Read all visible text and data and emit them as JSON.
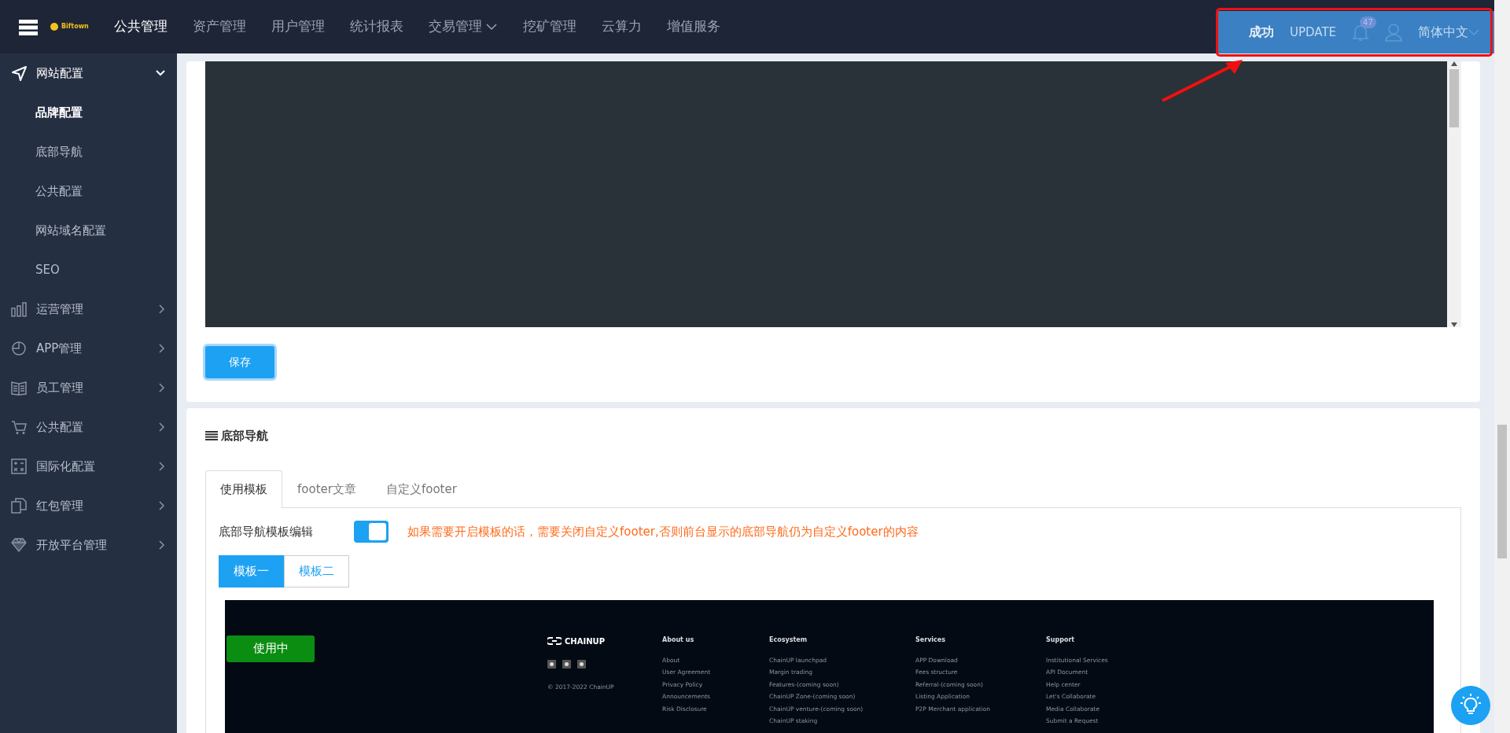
{
  "top_nav": {
    "brand": "Biftown",
    "items": [
      {
        "label": "公共管理",
        "selected": true,
        "dropdown": false
      },
      {
        "label": "资产管理",
        "selected": false,
        "dropdown": false
      },
      {
        "label": "用户管理",
        "selected": false,
        "dropdown": false
      },
      {
        "label": "统计报表",
        "selected": false,
        "dropdown": false
      },
      {
        "label": "交易管理",
        "selected": false,
        "dropdown": true
      },
      {
        "label": "挖矿管理",
        "selected": false,
        "dropdown": false
      },
      {
        "label": "云算力",
        "selected": false,
        "dropdown": false
      },
      {
        "label": "增值服务",
        "selected": false,
        "dropdown": false
      }
    ],
    "toast": "成功",
    "update": "UPDATE",
    "notification_count": "47",
    "language": "简体中文"
  },
  "sidebar": {
    "items": [
      {
        "label": "网站配置",
        "expanded": true,
        "children": [
          {
            "label": "品牌配置",
            "selected": true
          },
          {
            "label": "底部导航",
            "selected": false
          },
          {
            "label": "公共配置",
            "selected": false
          },
          {
            "label": "网站域名配置",
            "selected": false
          },
          {
            "label": "SEO",
            "selected": false
          }
        ]
      },
      {
        "label": "运营管理",
        "expanded": false
      },
      {
        "label": "APP管理",
        "expanded": false
      },
      {
        "label": "员工管理",
        "expanded": false
      },
      {
        "label": "公共配置",
        "expanded": false
      },
      {
        "label": "国际化配置",
        "expanded": false
      },
      {
        "label": "红包管理",
        "expanded": false
      },
      {
        "label": "开放平台管理",
        "expanded": false
      }
    ]
  },
  "editor_card": {
    "save_button": "保存"
  },
  "footer_card": {
    "title": "底部导航",
    "tabs": [
      {
        "label": "使用模板",
        "selected": true
      },
      {
        "label": "footer文章",
        "selected": false
      },
      {
        "label": "自定义footer",
        "selected": false
      }
    ],
    "toggle": {
      "label": "底部导航模板编辑",
      "on": true,
      "hint": "如果需要开启模板的话，需要关闭自定义footer,否则前台显示的底部导航仍为自定义footer的内容"
    },
    "templates": [
      {
        "label": "模板一",
        "selected": true
      },
      {
        "label": "模板二",
        "selected": false
      }
    ],
    "preview": {
      "status": "使用中",
      "logo": "CHAINUP",
      "copyright": "© 2017-2022 ChainUP",
      "columns": [
        {
          "heading": "About us",
          "links": [
            "About",
            "User Agreement",
            "Privacy Policy",
            "Announcements",
            "Risk Disclosure"
          ]
        },
        {
          "heading": "Ecosystem",
          "links": [
            "ChainUP launchpad",
            "Margin trading",
            "Features-(coming soon)",
            "ChainUP Zone-(coming soon)",
            "ChainUP venture-(coming soon)",
            "ChainUP staking"
          ]
        },
        {
          "heading": "Services",
          "links": [
            "APP Download",
            "Fees structure",
            "Referral-(coming soon)",
            "Listing Application",
            "P2P Merchant application"
          ]
        },
        {
          "heading": "Support",
          "links": [
            "Institutional Services",
            "API Document",
            "Help center",
            "Let's Collaborate",
            "Media Collaborate",
            "Submit a Request"
          ]
        }
      ]
    }
  }
}
